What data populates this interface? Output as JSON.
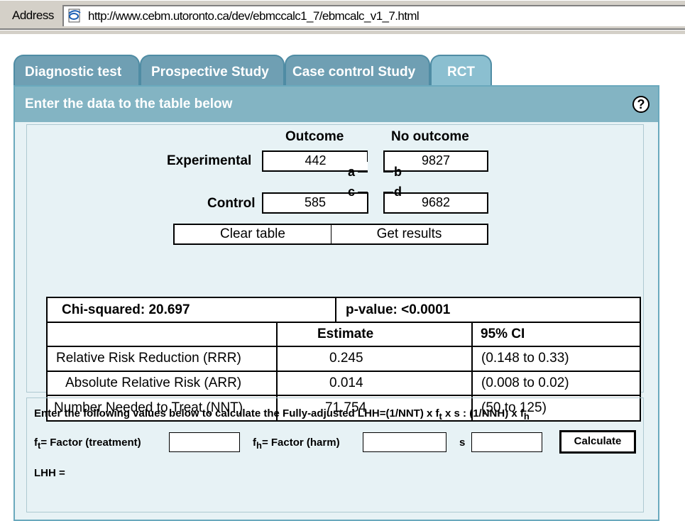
{
  "browser": {
    "address_label": "Address",
    "url": "http://www.cebm.utoronto.ca/dev/ebmccalc1_7/ebmcalc_v1_7.html"
  },
  "tabs": [
    {
      "label": "Diagnostic test",
      "active": false
    },
    {
      "label": "Prospective Study",
      "active": false
    },
    {
      "label": "Case control Study",
      "active": false
    },
    {
      "label": "RCT",
      "active": true
    }
  ],
  "panel": {
    "title": "Enter the data to the table below",
    "help": "?"
  },
  "table_input": {
    "col_outcome": "Outcome",
    "col_no_outcome": "No outcome",
    "row_experimental": "Experimental",
    "row_control": "Control",
    "a": "442",
    "b": "9827",
    "c": "585",
    "d": "9682",
    "letter_a": "a",
    "letter_b": "b",
    "letter_c": "c",
    "letter_d": "d",
    "clear_label": "Clear table",
    "get_label": "Get results"
  },
  "results": {
    "chi_squared": "Chi-squared: 20.697",
    "p_value": "p-value: <0.0001",
    "col_estimate": "Estimate",
    "col_ci": "95% CI",
    "rows": [
      {
        "label": "Relative Risk Reduction (RRR)",
        "estimate": "0.245",
        "ci": "(0.148 to 0.33)"
      },
      {
        "label": "Absolute Relative Risk (ARR)",
        "estimate": "0.014",
        "ci": "(0.008 to 0.02)"
      },
      {
        "label": "Number Needed to Treat (NNT)",
        "estimate": "71.754",
        "ci": "(50 to 125)"
      }
    ]
  },
  "lhh": {
    "instruction_prefix": "Enter the following values below to calculate the Fully-adjusted LHH=(1/NNT) x f",
    "sub_t": "t",
    "instruction_mid": " x s : (1/NNH) x f",
    "sub_h": "h",
    "ft_f": "f",
    "ft_label": "= Factor (treatment)",
    "fh_f": "f",
    "fh_label": "= Factor (harm)",
    "s_label": "s",
    "calculate_label": "Calculate",
    "result_label": "LHH ="
  }
}
